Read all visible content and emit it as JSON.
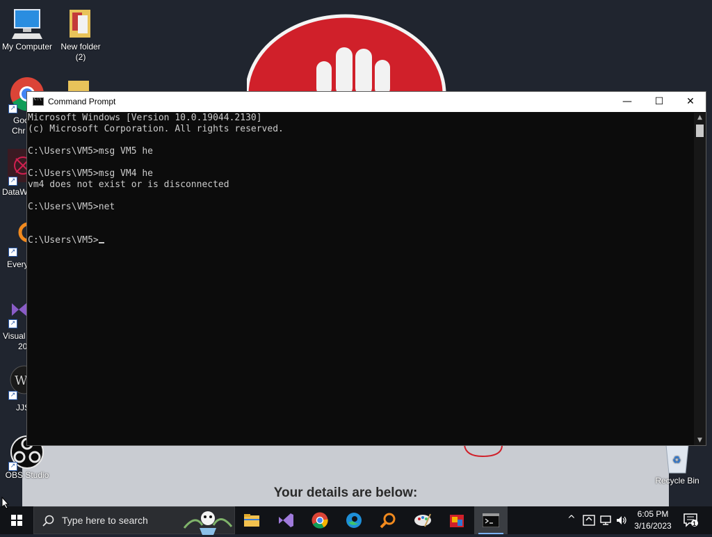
{
  "desktop": {
    "wallpaper_text": "Your details are below:",
    "icons": [
      {
        "label_1": "My Computer",
        "label_2": ""
      },
      {
        "label_1": "New folder",
        "label_2": "(2)"
      },
      {
        "label_1": "Goo",
        "label_2": "Chr"
      },
      {
        "label_1": "DataW",
        "label_2": ""
      },
      {
        "label_1": "Every",
        "label_2": ""
      },
      {
        "label_1": "Visual",
        "label_2": "20"
      },
      {
        "label_1": "JJS",
        "label_2": ""
      },
      {
        "label_1": "OBS Studio",
        "label_2": ""
      },
      {
        "label_1": "Recycle Bin",
        "label_2": ""
      }
    ]
  },
  "window": {
    "title": "Command Prompt",
    "minimize": "—",
    "maximize": "☐",
    "close": "✕",
    "lines": [
      "Microsoft Windows [Version 10.0.19044.2130]",
      "(c) Microsoft Corporation. All rights reserved.",
      "",
      "C:\\Users\\VM5>msg VM5 he",
      "",
      "C:\\Users\\VM5>msg VM4 he",
      "vm4 does not exist or is disconnected",
      "",
      "C:\\Users\\VM5>net",
      "",
      "",
      "C:\\Users\\VM5>"
    ]
  },
  "taskbar": {
    "search_placeholder": "Type here to search",
    "time": "6:05 PM",
    "date": "3/16/2023",
    "notification_count": "1",
    "accent": "#7cb3ff"
  }
}
